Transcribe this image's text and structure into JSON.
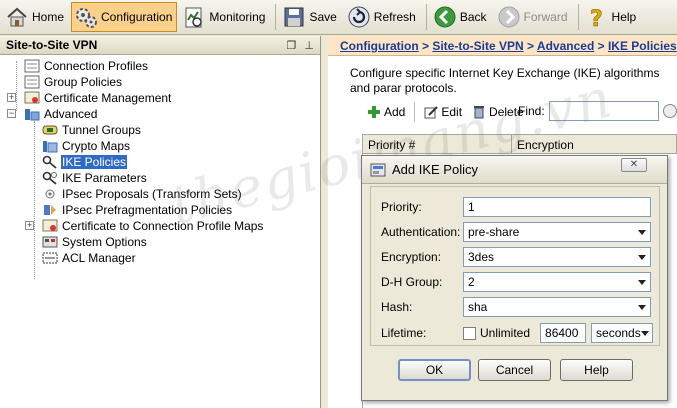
{
  "toolbar": {
    "home": "Home",
    "configuration": "Configuration",
    "monitoring": "Monitoring",
    "save": "Save",
    "refresh": "Refresh",
    "back": "Back",
    "forward": "Forward",
    "help": "Help"
  },
  "left_panel": {
    "title": "Site-to-Site VPN",
    "tree": {
      "connection_profiles": "Connection Profiles",
      "group_policies": "Group Policies",
      "certificate_management": "Certificate Management",
      "advanced": "Advanced",
      "tunnel_groups": "Tunnel Groups",
      "crypto_maps": "Crypto Maps",
      "ike_policies": "IKE Policies",
      "ike_parameters": "IKE Parameters",
      "ipsec_proposals": "IPsec Proposals (Transform Sets)",
      "ipsec_prefrag": "IPsec Prefragmentation Policies",
      "cert_to_profile_maps": "Certificate to Connection Profile Maps",
      "system_options": "System Options",
      "acl_manager": "ACL Manager"
    }
  },
  "right_panel": {
    "breadcrumb": [
      "Configuration",
      "Site-to-Site VPN",
      "Advanced",
      "IKE Policies"
    ],
    "breadcrumb_sep": " > ",
    "description": "Configure specific Internet Key Exchange (IKE) algorithms and parar protocols.",
    "actions": {
      "add": "Add",
      "edit": "Edit",
      "delete": "Delete"
    },
    "find_label": "Find:",
    "table_columns": [
      "Priority #",
      "Encryption"
    ]
  },
  "dialog": {
    "title": "Add IKE Policy",
    "priority_label": "Priority:",
    "priority_value": "1",
    "authentication_label": "Authentication:",
    "authentication_value": "pre-share",
    "encryption_label": "Encryption:",
    "encryption_value": "3des",
    "dh_group_label": "D-H Group:",
    "dh_group_value": "2",
    "hash_label": "Hash:",
    "hash_value": "sha",
    "lifetime_label": "Lifetime:",
    "unlimited_label": "Unlimited",
    "lifetime_value": "86400",
    "lifetime_unit": "seconds",
    "ok": "OK",
    "cancel": "Cancel",
    "help": "Help"
  },
  "watermark": "thegioimang.vn",
  "colors": {
    "active_toolbar": "#fbd08b",
    "breadcrumb_bg": "#fde5c6",
    "link": "#1a3c96",
    "selection": "#316ac5"
  }
}
